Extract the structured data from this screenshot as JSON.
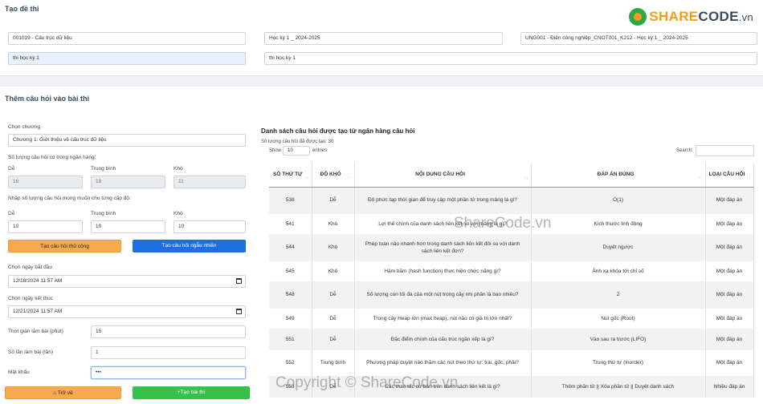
{
  "page_title": "Tạo đề thi",
  "logo": {
    "share": "SHARE",
    "code": "CODE",
    "vn": ".vn"
  },
  "exam": {
    "subject": "001019 - Cấu trúc dữ liệu",
    "semester": "Học kỳ 1 _ 2024-2025",
    "class": "UNG001 - Điện công nghiệp_CNOT001_K212 - Học kỳ 1 _ 2024-2025",
    "name_left": "thi học kỳ 1",
    "name_right": "thi học kỳ 1"
  },
  "section_title": "Thêm câu hỏi vào bài thi",
  "form": {
    "chapter_label": "Chọn chương",
    "chapter_value": "Chương 1: Giới thiệu về cấu trúc dữ liệu",
    "bank_count_label": "Số lượng câu hỏi có trong ngân hàng:",
    "level_easy": "Dễ",
    "level_medium": "Trung bình",
    "level_hard": "Khó",
    "bank_easy": "16",
    "bank_medium": "18",
    "bank_hard": "11",
    "want_count_label": "Nhập số lượng câu hỏi mong muốn cho từng cấp độ:",
    "want_easy": "10",
    "want_medium": "10",
    "want_hard": "10",
    "manual_button": "Tạo câu hỏi thủ công",
    "random_button": "Tạo câu hỏi ngẫu nhiên",
    "start_label": "Chọn ngày bắt đầu",
    "start_value": "12/18/2024 11:57 AM",
    "end_label": "Chọn ngày kết thúc",
    "end_value": "12/21/2024 11:57 AM",
    "duration_label": "Thời gian làm bài (phút)",
    "duration_value": "15",
    "attempts_label": "Số lần làm bài (lần)",
    "attempts_value": "1",
    "password_label": "Mật khẩu",
    "password_value": "•••",
    "back_button": "Trở về",
    "create_button": "Tạo bài thi"
  },
  "list": {
    "title": "Danh sách câu hỏi được tạo từ ngân hàng câu hỏi",
    "count_text": "Số lượng câu hỏi đã được tạo: 30",
    "show_label": "Show",
    "show_value": "10",
    "entries_label": "entries",
    "search_label": "Search:",
    "columns": [
      "SỐ THỨ TỰ",
      "ĐỘ KHÓ",
      "NỘI DUNG CÂU HỎI",
      "ĐÁP ÁN ĐÚNG",
      "LOẠI CÂU HỎI"
    ],
    "rows": [
      [
        "538",
        "Dễ",
        "Độ phức tạp thời gian để truy cập một phần tử trong mảng là gì?",
        "O(1)",
        "Một đáp án"
      ],
      [
        "541",
        "Khó",
        "Lợi thế chính của danh sách liên kết so với mảng là gì?",
        "Kích thước linh động",
        "Một đáp án"
      ],
      [
        "544",
        "Khó",
        "Phép toán nào nhanh hơn trong danh sách liên kết đôi so với danh sách liên kết đơn?",
        "Duyệt ngược",
        "Một đáp án"
      ],
      [
        "545",
        "Khó",
        "Hàm băm (hash function) thực hiện chức năng gì?",
        "Ánh xạ khóa tới chỉ số",
        "Một đáp án"
      ],
      [
        "548",
        "Dễ",
        "Số lượng con tối đa của một nút trong cây nhị phân là bao nhiêu?",
        "2",
        "Một đáp án"
      ],
      [
        "549",
        "Dễ",
        "Trong cây Heap lớn (max heap), nút nào có giá trị lớn nhất?",
        "Nút gốc (Root)",
        "Một đáp án"
      ],
      [
        "551",
        "Dễ",
        "Đặc điểm chính của cấu trúc ngăn xếp là gì?",
        "Vào sau ra trước (LIFO)",
        "Một đáp án"
      ],
      [
        "552",
        "Trung bình",
        "Phương pháp duyệt nào thăm các nút theo thứ tự: trái, gốc, phải?",
        "Trung thứ tự (Inorder)",
        "Một đáp án"
      ],
      [
        "553",
        "Dễ",
        "Các thao tác cơ bản trên danh sách liên kết là gì?",
        "Thêm phần tử || Xóa phần tử || Duyệt danh sách",
        "Nhiều đáp án"
      ]
    ]
  },
  "watermarks": {
    "center": "ShareCode.vn",
    "bottom": "Copyright © ShareCode.vn"
  }
}
